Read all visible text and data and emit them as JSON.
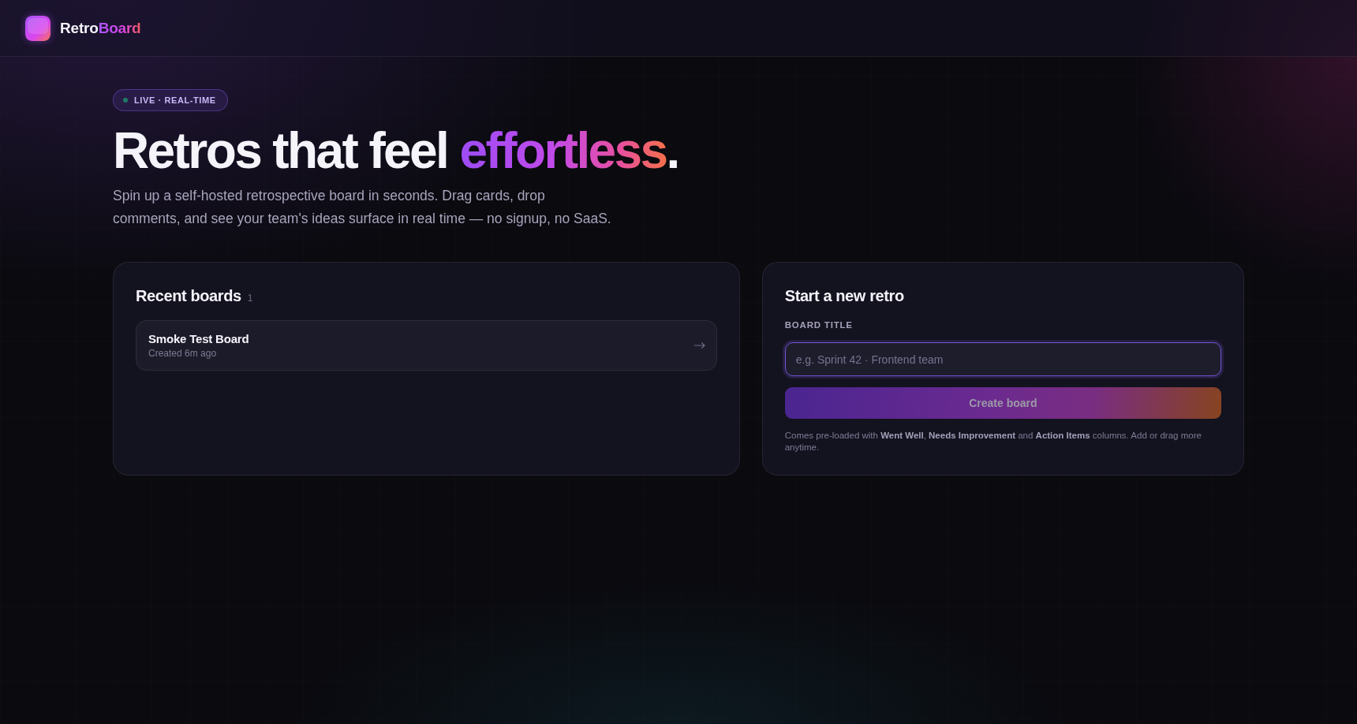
{
  "header": {
    "logo": {
      "text": "Retro",
      "accent": "Board"
    }
  },
  "hero": {
    "badge": "LIVE · REAL-TIME",
    "title": "Retros that feel",
    "title_highlight": "effortless",
    "title_end": ".",
    "subtitle": "Spin up a self-hosted retrospective board in seconds. Drag cards, drop comments, and see your team's ideas surface in real time — no signup, no SaaS."
  },
  "recent_boards": {
    "title": "Recent boards",
    "count": "1",
    "boards": [
      {
        "name": "Smoke Test Board",
        "created": "Created 6m ago"
      }
    ]
  },
  "new_retro": {
    "title": "Start a new retro",
    "field": {
      "label": "BOARD TITLE",
      "placeholder": "e.g. Sprint 42 · Frontend team",
      "focused": true
    },
    "button": {
      "label": "Create board",
      "disabled": true
    },
    "note": "Comes pre-loaded with **Went Well**, **Needs Improvement** and **Action Items** columns. Add or drag more anytime."
  }
}
